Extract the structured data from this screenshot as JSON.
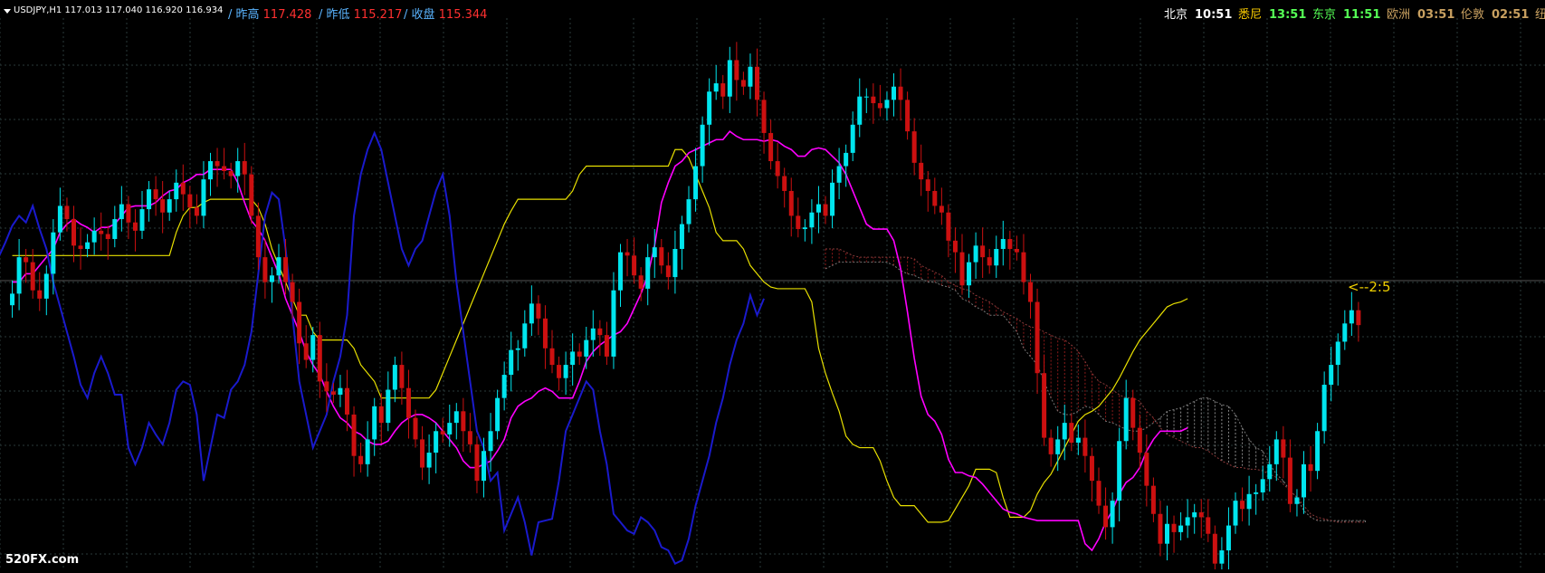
{
  "header": {
    "symbol": "USDJPY,H1  117.013 117.040 116.920 116.934",
    "prev_high_label": "/ 昨高",
    "prev_high_value": "117.428",
    "prev_low_label": "/ 昨低",
    "prev_low_value": "115.217",
    "close_label": "/ 收盘",
    "close_value": "115.344"
  },
  "clocks": [
    {
      "city": "北京",
      "time": "10:51",
      "city_color": "#ffffff",
      "time_color": "#ffffff"
    },
    {
      "city": "悉尼",
      "time": "13:51",
      "city_color": "#ffd000",
      "time_color": "#55ff55"
    },
    {
      "city": "东京",
      "time": "11:51",
      "city_color": "#55ff55",
      "time_color": "#55ff55"
    },
    {
      "city": "欧洲",
      "time": "03:51",
      "city_color": "#c8a060",
      "time_color": "#c8a060"
    },
    {
      "city": "伦敦",
      "time": "02:51",
      "city_color": "#c8a060",
      "time_color": "#c8a060"
    },
    {
      "city": "纽约",
      "time": "",
      "city_color": "#c8a060",
      "time_color": "#c8a060"
    }
  ],
  "annotation": "<--2:5",
  "watermark": "520FX.com",
  "colors": {
    "background": "#000000",
    "grid": "#2a3a3a",
    "bull": "#00e5ee",
    "bear": "#cc1010",
    "tenkan": "#ff00ff",
    "kijun": "#e8e000",
    "chikou": "#1a1acc",
    "cloud_bull": "#888888",
    "cloud_bear": "#8b1a1a"
  },
  "chart_data": {
    "type": "candlestick",
    "instrument": "USDJPY",
    "timeframe": "H1",
    "price_range": [
      114.78,
      117.95
    ],
    "close_series": [
      116.26,
      116.33,
      116.55,
      116.52,
      116.35,
      116.3,
      116.45,
      116.7,
      116.86,
      116.78,
      116.62,
      116.6,
      116.64,
      116.71,
      116.69,
      116.66,
      116.78,
      116.87,
      116.76,
      116.71,
      116.84,
      116.96,
      116.9,
      116.82,
      116.9,
      117.0,
      116.93,
      116.85,
      116.8,
      117.02,
      117.13,
      117.1,
      117.07,
      117.04,
      117.13,
      117.05,
      116.8,
      116.55,
      116.4,
      116.44,
      116.55,
      116.4,
      116.28,
      116.03,
      115.93,
      116.08,
      115.8,
      115.74,
      115.72,
      115.76,
      115.6,
      115.35,
      115.3,
      115.45,
      115.65,
      115.55,
      115.75,
      115.9,
      115.76,
      115.58,
      115.45,
      115.28,
      115.37,
      115.5,
      115.48,
      115.55,
      115.62,
      115.5,
      115.42,
      115.2,
      115.38,
      115.5,
      115.7,
      115.84,
      115.99,
      116.0,
      116.15,
      116.27,
      116.18,
      116.0,
      115.9,
      115.82,
      115.9,
      115.98,
      115.95,
      116.05,
      116.12,
      116.08,
      115.95,
      116.35,
      116.58,
      116.56,
      116.44,
      116.36,
      116.55,
      116.61,
      116.5,
      116.43,
      116.6,
      116.75,
      116.9,
      117.1,
      117.35,
      117.55,
      117.6,
      117.52,
      117.74,
      117.62,
      117.58,
      117.7,
      117.5,
      117.3,
      117.13,
      117.04,
      116.95,
      116.8,
      116.72,
      116.73,
      116.82,
      116.87,
      116.8,
      117.0,
      117.1,
      117.18,
      117.35,
      117.52,
      117.52,
      117.48,
      117.45,
      117.5,
      117.58,
      117.5,
      117.31,
      117.12,
      117.02,
      116.95,
      116.86,
      116.82,
      116.65,
      116.58,
      116.38,
      116.52,
      116.62,
      116.55,
      116.5,
      116.6,
      116.66,
      116.6,
      116.58,
      116.4,
      116.28,
      115.85,
      115.46,
      115.36,
      115.45,
      115.55,
      115.43,
      115.46,
      115.35,
      115.2,
      115.05,
      114.92,
      115.08,
      115.44,
      115.7,
      115.52,
      115.37,
      115.17,
      115.0,
      114.82,
      114.94,
      114.89,
      114.93,
      114.98,
      115.01,
      114.98,
      114.88,
      114.7,
      114.78,
      114.93,
      115.08,
      115.03,
      115.12,
      115.13,
      115.21,
      115.3,
      115.45,
      115.34,
      115.06,
      115.1,
      115.3,
      115.26,
      115.5,
      115.78,
      115.9,
      116.04,
      116.15,
      116.23,
      116.14
    ],
    "tenkan_series": [
      116.4,
      116.4,
      116.45,
      116.45,
      116.5,
      116.55,
      116.6,
      116.7,
      116.75,
      116.78,
      116.75,
      116.73,
      116.7,
      116.73,
      116.73,
      116.75,
      116.8,
      116.85,
      116.86,
      116.86,
      116.86,
      116.88,
      116.92,
      116.95,
      116.96,
      117.0,
      117.02,
      117.05,
      117.05,
      117.08,
      117.08,
      117.08,
      117.08,
      117.0,
      116.88,
      116.77,
      116.72,
      116.65,
      116.55,
      116.45,
      116.3,
      116.2,
      116.1,
      115.98,
      115.9,
      115.84,
      115.74,
      115.65,
      115.58,
      115.55,
      115.5,
      115.48,
      115.44,
      115.42,
      115.42,
      115.44,
      115.5,
      115.55,
      115.58,
      115.6,
      115.6,
      115.58,
      115.55,
      115.5,
      115.45,
      115.4,
      115.32,
      115.28,
      115.28,
      115.3,
      115.32,
      115.38,
      115.45,
      115.58,
      115.65,
      115.68,
      115.7,
      115.74,
      115.76,
      115.74,
      115.7,
      115.7,
      115.7,
      115.8,
      115.92,
      115.98,
      116.02,
      116.05,
      116.08,
      116.1,
      116.15,
      116.24,
      116.33,
      116.44,
      116.62,
      116.88,
      117.0,
      117.1,
      117.13,
      117.18,
      117.2,
      117.22,
      117.24,
      117.26,
      117.26,
      117.31,
      117.28,
      117.26,
      117.26,
      117.26,
      117.25,
      117.26,
      117.25,
      117.22,
      117.2,
      117.16,
      117.16,
      117.2,
      117.21,
      117.2,
      117.16,
      117.12,
      117.05,
      116.95,
      116.85,
      116.75,
      116.72,
      116.72,
      116.72,
      116.65,
      116.48,
      116.22,
      115.94,
      115.71,
      115.6,
      115.56,
      115.48,
      115.33,
      115.25,
      115.25,
      115.23,
      115.22,
      115.18,
      115.13,
      115.08,
      115.03,
      115.01,
      115.0,
      114.98,
      114.97,
      114.96,
      114.96,
      114.96,
      114.96,
      114.96,
      114.96,
      114.96,
      114.82,
      114.78,
      114.85,
      114.95,
      115.02,
      115.12,
      115.19,
      115.22,
      115.28,
      115.38,
      115.45,
      115.5,
      115.5,
      115.5,
      115.5,
      115.52
    ],
    "kijun_series": [
      116.56,
      116.56,
      116.56,
      116.56,
      116.56,
      116.56,
      116.56,
      116.56,
      116.56,
      116.56,
      116.56,
      116.56,
      116.56,
      116.56,
      116.56,
      116.56,
      116.56,
      116.56,
      116.56,
      116.56,
      116.56,
      116.56,
      116.56,
      116.56,
      116.7,
      116.8,
      116.85,
      116.85,
      116.88,
      116.9,
      116.9,
      116.9,
      116.9,
      116.9,
      116.9,
      116.9,
      116.85,
      116.75,
      116.6,
      116.5,
      116.4,
      116.3,
      116.2,
      116.2,
      116.1,
      116.05,
      116.05,
      116.05,
      116.05,
      116.05,
      116.0,
      115.9,
      115.85,
      115.8,
      115.7,
      115.7,
      115.7,
      115.7,
      115.7,
      115.7,
      115.7,
      115.7,
      115.75,
      115.85,
      115.95,
      116.05,
      116.15,
      116.25,
      116.35,
      116.45,
      116.55,
      116.65,
      116.75,
      116.83,
      116.9,
      116.9,
      116.9,
      116.9,
      116.9,
      116.9,
      116.9,
      116.9,
      116.95,
      117.05,
      117.1,
      117.1,
      117.1,
      117.1,
      117.1,
      117.1,
      117.1,
      117.1,
      117.1,
      117.1,
      117.1,
      117.1,
      117.1,
      117.2,
      117.2,
      117.15,
      117.05,
      116.95,
      116.85,
      116.7,
      116.65,
      116.65,
      116.65,
      116.6,
      116.5,
      116.45,
      116.4,
      116.37,
      116.36,
      116.36,
      116.36,
      116.36,
      116.36,
      116.28,
      116.0,
      115.85,
      115.73,
      115.62,
      115.47,
      115.42,
      115.4,
      115.4,
      115.4,
      115.32,
      115.2,
      115.1,
      115.05,
      115.05,
      115.05,
      115.0,
      114.95,
      114.95,
      114.95,
      114.96,
      115.03,
      115.1,
      115.17,
      115.27,
      115.27,
      115.27,
      115.25,
      115.1,
      114.98,
      114.98,
      114.98,
      115.02,
      115.12,
      115.19,
      115.24,
      115.32,
      115.4,
      115.48,
      115.56,
      115.6,
      115.62,
      115.65,
      115.7,
      115.75,
      115.82,
      115.9,
      115.98,
      116.05,
      116.1,
      116.15,
      116.2,
      116.25,
      116.27,
      116.28,
      116.3
    ],
    "span_a_series": [
      116.48,
      116.5,
      116.52,
      116.52,
      116.52,
      116.52,
      116.52,
      116.52,
      116.52,
      116.52,
      116.5,
      116.47,
      116.45,
      116.44,
      116.42,
      116.4,
      116.4,
      116.38,
      116.37,
      116.35,
      116.3,
      116.28,
      116.25,
      116.23,
      116.2,
      116.2,
      116.2,
      116.15,
      116.1,
      116.0,
      115.95,
      115.9,
      115.8,
      115.7,
      115.62,
      115.6,
      115.6,
      115.62,
      115.65,
      115.64,
      115.6,
      115.56,
      115.55,
      115.53,
      115.51,
      115.5,
      115.5,
      115.52,
      115.55,
      115.58,
      115.62,
      115.63,
      115.64,
      115.66,
      115.68,
      115.7,
      115.7,
      115.68,
      115.66,
      115.65,
      115.6,
      115.52,
      115.45,
      115.4,
      115.38,
      115.3,
      115.24,
      115.2,
      115.14,
      115.1,
      115.02,
      114.98,
      114.96,
      114.96,
      114.96,
      114.96,
      114.96,
      114.96,
      114.96,
      114.96
    ],
    "span_b_series": [
      116.6,
      116.6,
      116.6,
      116.58,
      116.56,
      116.55,
      116.55,
      116.55,
      116.55,
      116.55,
      116.55,
      116.55,
      116.55,
      116.54,
      116.5,
      116.48,
      116.46,
      116.44,
      116.4,
      116.38,
      116.36,
      116.35,
      116.32,
      116.3,
      116.28,
      116.25,
      116.22,
      116.2,
      116.18,
      116.15,
      116.13,
      116.12,
      116.1,
      116.08,
      116.06,
      116.05,
      116.02,
      115.98,
      115.92,
      115.85,
      115.8,
      115.78,
      115.75,
      115.72,
      115.7,
      115.7,
      115.68,
      115.62,
      115.58,
      115.52,
      115.48,
      115.46,
      115.44,
      115.42,
      115.4,
      115.4,
      115.38,
      115.35,
      115.32,
      115.3,
      115.28,
      115.28,
      115.27,
      115.27,
      115.26,
      115.24,
      115.22,
      115.18,
      115.14,
      115.1,
      115.05,
      115.0,
      114.98,
      114.97,
      114.96,
      114.95,
      114.95,
      114.95,
      114.95,
      114.95
    ],
    "chikou_series": [
      116.55,
      116.64,
      116.74,
      116.8,
      116.76,
      116.86,
      116.72,
      116.6,
      116.4,
      116.25,
      116.1,
      115.95,
      115.78,
      115.7,
      115.85,
      115.95,
      115.85,
      115.72,
      115.72,
      115.4,
      115.3,
      115.4,
      115.55,
      115.48,
      115.42,
      115.55,
      115.75,
      115.8,
      115.78,
      115.6,
      115.2,
      115.4,
      115.6,
      115.58,
      115.75,
      115.8,
      115.9,
      116.1,
      116.45,
      116.8,
      116.94,
      116.9,
      116.6,
      116.2,
      115.8,
      115.6,
      115.4,
      115.5,
      115.6,
      115.8,
      115.95,
      116.2,
      116.8,
      117.05,
      117.2,
      117.3,
      117.2,
      117.0,
      116.8,
      116.6,
      116.5,
      116.6,
      116.65,
      116.8,
      116.95,
      117.05,
      116.8,
      116.4,
      116.1,
      115.8,
      115.5,
      115.4,
      115.2,
      115.25,
      114.9,
      115.0,
      115.1,
      114.95,
      114.75,
      114.95,
      114.96,
      114.97,
      115.2,
      115.5,
      115.6,
      115.7,
      115.8,
      115.75,
      115.5,
      115.3,
      115.0,
      114.95,
      114.9,
      114.88,
      114.98,
      114.95,
      114.9,
      114.8,
      114.78,
      114.7,
      114.72,
      114.85,
      115.05,
      115.2,
      115.35,
      115.55,
      115.7,
      115.9,
      116.05,
      116.15,
      116.32,
      116.2,
      116.3
    ]
  }
}
